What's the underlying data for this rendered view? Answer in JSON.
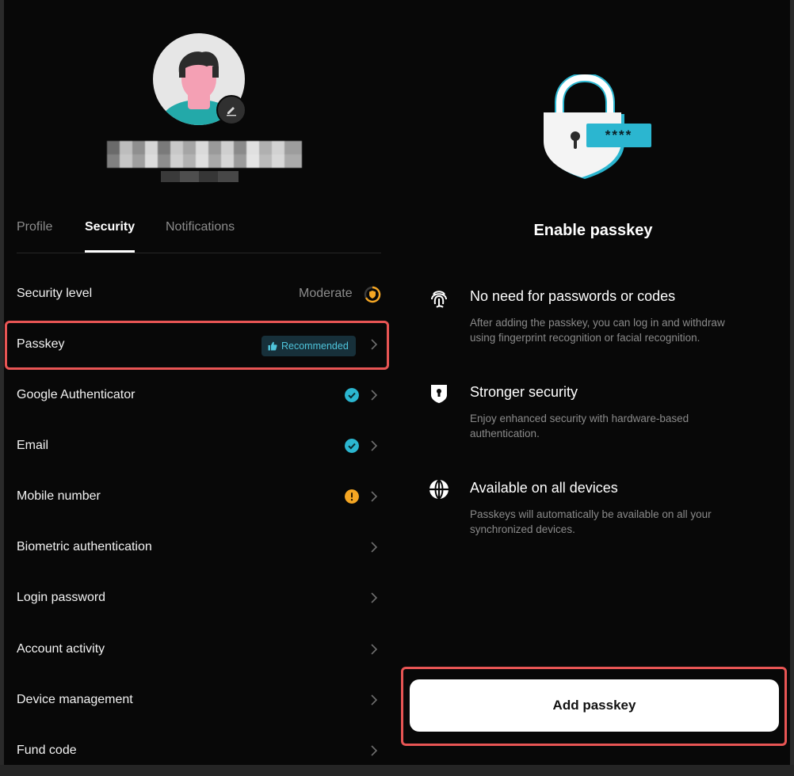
{
  "tabs": [
    {
      "label": "Profile"
    },
    {
      "label": "Security"
    },
    {
      "label": "Notifications"
    }
  ],
  "active_tab": "Security",
  "security_level": {
    "label": "Security level",
    "value": "Moderate"
  },
  "rows": [
    {
      "label": "Passkey",
      "badge": "Recommended"
    },
    {
      "label": "Google Authenticator",
      "status": "verified"
    },
    {
      "label": "Email",
      "status": "verified"
    },
    {
      "label": "Mobile number",
      "status": "warning"
    },
    {
      "label": "Biometric authentication"
    },
    {
      "label": "Login password"
    },
    {
      "label": "Account activity"
    },
    {
      "label": "Device management"
    },
    {
      "label": "Fund code"
    }
  ],
  "passkey_panel": {
    "masked_code": "****",
    "title": "Enable passkey",
    "features": [
      {
        "icon": "fingerprint-icon",
        "title": "No need for passwords or codes",
        "desc": "After adding the passkey, you can log in and withdraw using fingerprint recognition or facial recognition."
      },
      {
        "icon": "shield-lock-icon",
        "title": "Stronger security",
        "desc": "Enjoy enhanced security with hardware-based authentication."
      },
      {
        "icon": "globe-icon",
        "title": "Available on all devices",
        "desc": "Passkeys will automatically be available on all your synchronized devices."
      }
    ],
    "button_label": "Add passkey"
  },
  "colors": {
    "accent": "#2bb6d0",
    "warning": "#f5a623",
    "highlight": "#e85554",
    "background": "#080808"
  }
}
